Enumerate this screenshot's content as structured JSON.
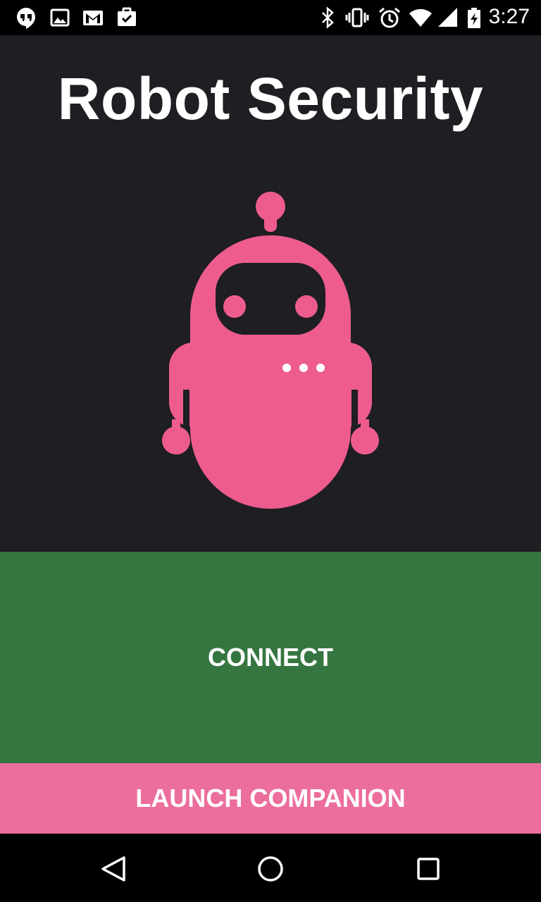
{
  "status_bar": {
    "time": "3:27",
    "left_icons": [
      "hangouts-icon",
      "image-icon",
      "gmail-icon",
      "clipboard-check-icon"
    ],
    "right_icons": [
      "bluetooth-icon",
      "vibrate-icon",
      "alarm-icon",
      "wifi-icon",
      "signal-icon",
      "battery-charging-icon"
    ]
  },
  "app": {
    "title": "Robot Security",
    "logo": "robot-icon",
    "colors": {
      "background": "#1e1e23",
      "robot": "#ee5c8e",
      "connect": "#357640",
      "companion": "#ec6e9d"
    }
  },
  "buttons": {
    "connect_label": "CONNECT",
    "companion_label": "LAUNCH COMPANION"
  },
  "nav_bar": {
    "icons": [
      "back-icon",
      "home-icon",
      "recents-icon"
    ]
  }
}
